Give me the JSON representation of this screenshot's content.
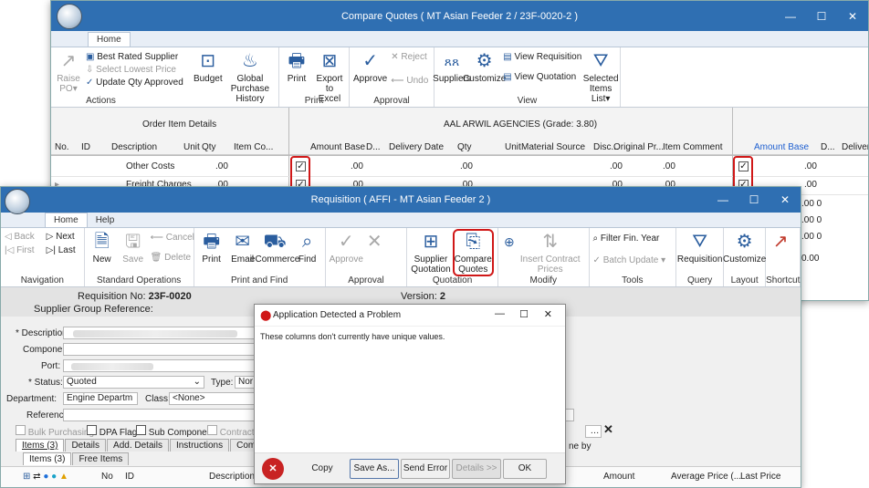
{
  "cq": {
    "title": "Compare Quotes ( MT Asian Feeder 2 / 23F-0020-2 )",
    "tab": "Home",
    "ribbon": {
      "raise": "Raise",
      "raise_sub": "PO",
      "best_rated": "Best Rated Supplier",
      "select_lowest": "Select Lowest Price",
      "update_qty": "Update Qty Approved",
      "actions_label": "Actions",
      "budget": "Budget",
      "gph": "Global Purchase",
      "gph2": "History",
      "print": "Print",
      "export": "Export to",
      "export2": "Excel",
      "print_label": "Print",
      "approve": "Approve",
      "reject": "Reject",
      "undo": "Undo",
      "approval_label": "Approval",
      "suppliers": "Suppliers",
      "customize": "Customize",
      "view_req": "View Requisition",
      "view_quote": "View Quotation",
      "selected": "Selected",
      "selected2": "Items List",
      "view_label": "View"
    },
    "grid": {
      "group1": "Order Item Details",
      "group2": "AAL ARWIL AGENCIES (Grade: 3.80)",
      "cols1": [
        "No.",
        "ID",
        "Description",
        "Unit",
        "Qty",
        "Item Co..."
      ],
      "cols2": [
        "Amount Base",
        "D...",
        "Delivery Date",
        "Qty",
        "Unit",
        "Material Source",
        "Disc...",
        "Original Pr...",
        "Item Comment"
      ],
      "cols3": [
        "Amount Base",
        "D...",
        "Delivery"
      ],
      "rows": [
        {
          "desc": "Other Costs",
          "qty": ".00",
          "amt": ".00",
          "qty2": ".00",
          "disc": ".00",
          "orig": ".00",
          "amt3": ".00"
        },
        {
          "desc": "Freight Charges",
          "qty": ".00",
          "amt": ".00",
          "qty2": ".00",
          "disc": ".00",
          "orig": ".00",
          "amt3": ".00"
        }
      ],
      "extra": [
        ".00  0",
        ".00  0",
        ".00  0",
        "0.00"
      ]
    }
  },
  "req": {
    "title": "Requisition ( AFFI - MT Asian Feeder 2 )",
    "tabs": [
      "Home",
      "Help"
    ],
    "nav": {
      "back": "Back",
      "next": "Next",
      "first": "First",
      "last": "Last",
      "label": "Navigation"
    },
    "std": {
      "new": "New",
      "save": "Save",
      "cancel": "Cancel",
      "delete": "Delete",
      "label": "Standard Operations"
    },
    "pf": {
      "print": "Print",
      "email": "Email",
      "ecommerce": "eCommerce",
      "find": "Find",
      "label": "Print and Find"
    },
    "appr": {
      "approve": "Approve",
      "label": "Approval"
    },
    "quot": {
      "supplier": "Supplier",
      "supplier2": "Quotation",
      "compare": "Compare",
      "compare2": "Quotes",
      "label": "Quotation"
    },
    "mod": {
      "insert": "Insert Contract",
      "insert2": "Prices",
      "label": "Modify"
    },
    "tools": {
      "filter": "Filter Fin. Year",
      "batch": "Batch Update",
      "label": "Tools"
    },
    "query": {
      "req": "Requisition",
      "label": "Query"
    },
    "layout": {
      "customize": "Customize",
      "label": "Layout"
    },
    "shortcut": {
      "label": "Shortcut"
    },
    "reqno_label": "Requisition No:",
    "reqno": "23F-0020",
    "version_label": "Version:",
    "version": "2",
    "sgr": "Supplier Group Reference:",
    "fields": {
      "description": "* Description:",
      "component": "Component:",
      "port": "Port:",
      "status": "* Status:",
      "status_val": "Quoted",
      "type": "Type:",
      "type_val": "Nor",
      "department": "Department:",
      "department_val": "Engine Departm",
      "class": "Class:",
      "class_val": "<None>",
      "reference": "Reference:"
    },
    "flags": [
      "Bulk Purchasing",
      "DPA Flag",
      "Sub Component",
      "Contract"
    ],
    "tabs2": [
      "Items (3)",
      "Details",
      "Add. Details",
      "Instructions",
      "Comments"
    ],
    "subtabs": [
      "Items (3)",
      "Free Items"
    ],
    "cols": [
      "No",
      "ID",
      "Description",
      "Amount",
      "Average Price (...",
      "Last Price"
    ],
    "by_tab": "ne by"
  },
  "dlg": {
    "title": "Application Detected a Problem",
    "message": "These columns don't currently have unique values.",
    "buttons": [
      "Copy",
      "Save As...",
      "Send Error",
      "Details >>",
      "OK"
    ]
  }
}
